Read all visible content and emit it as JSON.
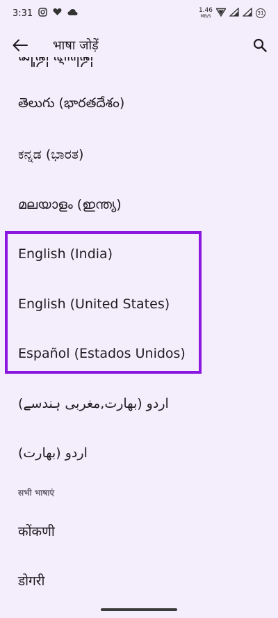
{
  "status": {
    "time": "3:31",
    "net_speed": "1.46",
    "net_unit": "MB/S",
    "battery": "31"
  },
  "app_bar": {
    "title": "भाषा जोड़ें"
  },
  "cut_item": "ꦱꦸꦤ꧀ꦝ ꦆꦤ꧀ꦝꦺ",
  "suggested_languages": [
    "తెలుగు (భారతదేశం)",
    "ಕನ್ನಡ (ಭಾರತ)",
    "മലയാളം (ഇന്ത്യ)",
    "English (India)",
    "English (United States)",
    "Español (Estados Unidos)",
    "اردو (بھارت,مغربی ہندسے)",
    "اردو (بھارت)"
  ],
  "section_all_languages": "सभी भाषाएं",
  "all_languages": [
    "कोंकणी",
    "डोगरी"
  ]
}
